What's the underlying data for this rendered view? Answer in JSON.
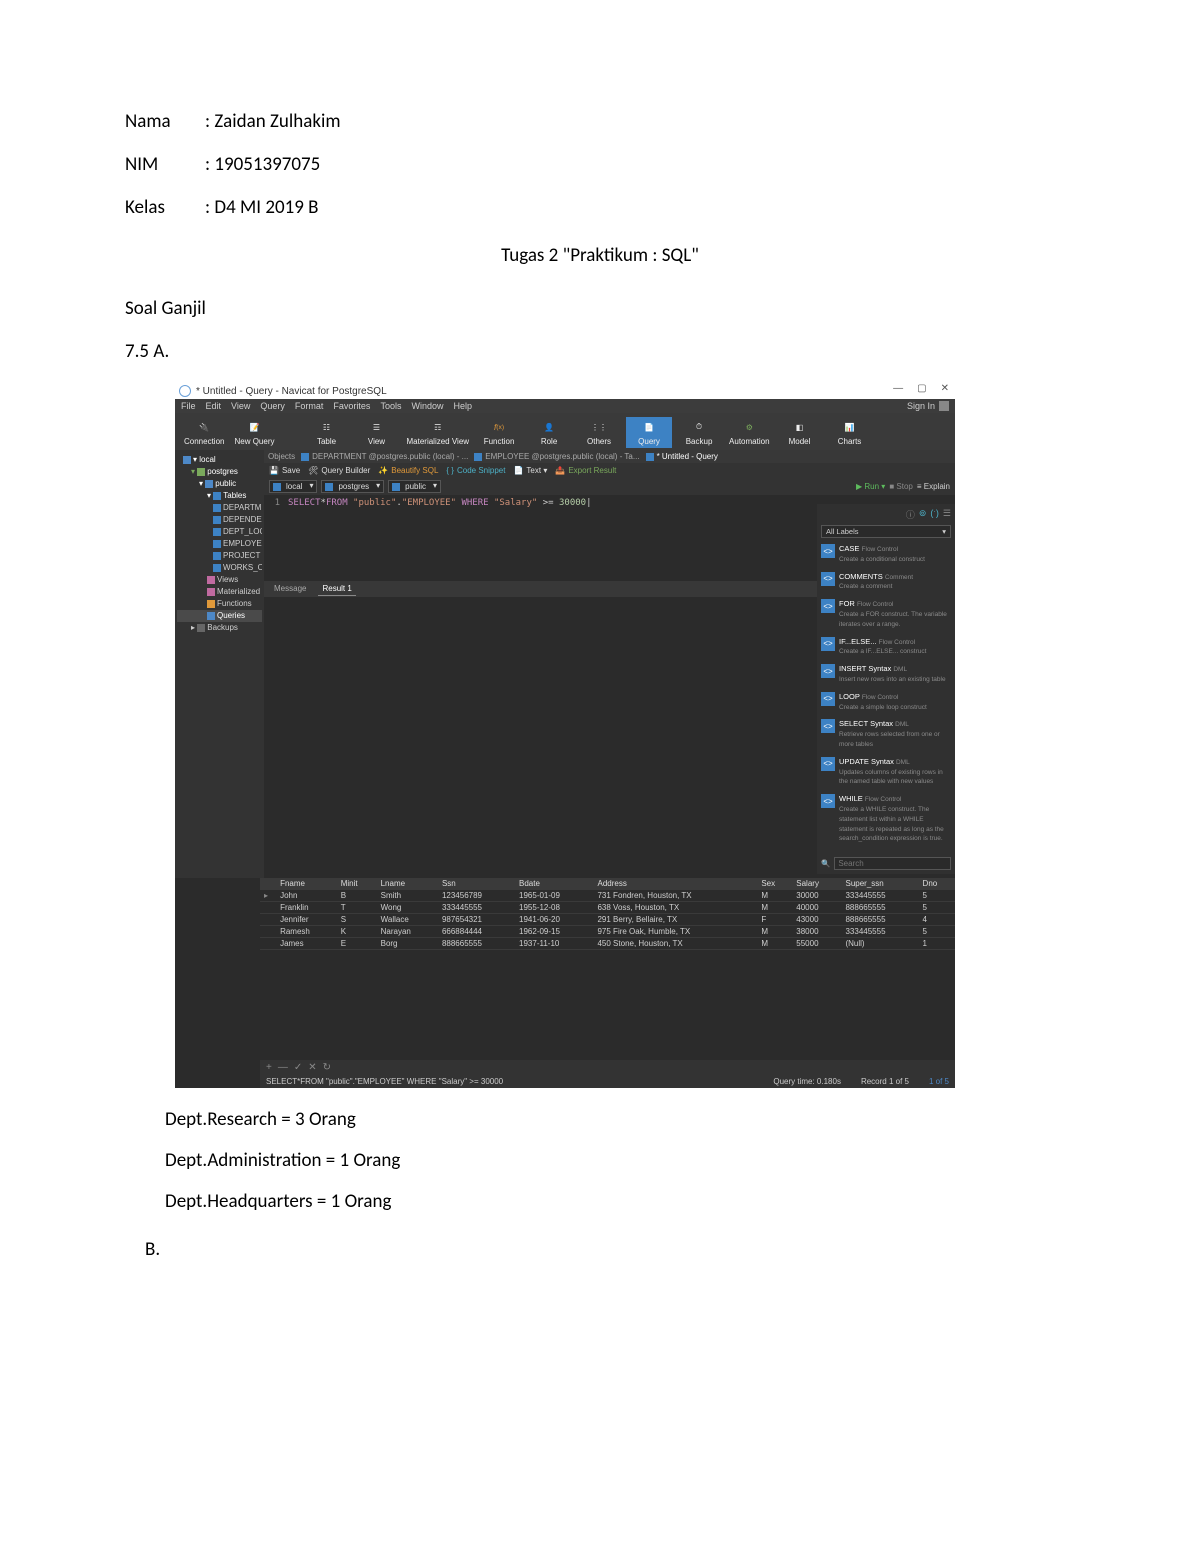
{
  "doc": {
    "nama_label": "Nama",
    "nim_label": "NIM",
    "kelas_label": "Kelas",
    "nama": ": Zaidan Zulhakim",
    "nim": ": 19051397075",
    "kelas": ": D4 MI 2019 B",
    "title": "Tugas 2 \"Praktikum : SQL\"",
    "soal": "Soal Ganjil",
    "q75a": "7.5 A.",
    "res1": "Dept.Research = 3 Orang",
    "res2": "Dept.Administration = 1 Orang",
    "res3": "Dept.Headquarters = 1 Orang",
    "B": "B."
  },
  "app": {
    "window_title": "* Untitled - Query - Navicat for PostgreSQL",
    "win_min": "—",
    "win_max": "▢",
    "win_close": "✕",
    "menus": [
      "File",
      "Edit",
      "View",
      "Query",
      "Format",
      "Favorites",
      "Tools",
      "Window",
      "Help"
    ],
    "signin": "Sign In",
    "toolbar": {
      "connection": "Connection",
      "newquery": "New Query",
      "table": "Table",
      "view": "View",
      "matview": "Materialized View",
      "function": "Function",
      "role": "Role",
      "others": "Others",
      "query": "Query",
      "backup": "Backup",
      "automation": "Automation",
      "model": "Model",
      "charts": "Charts"
    },
    "tree": {
      "local": "local",
      "postgres": "postgres",
      "public": "public",
      "tables": "Tables",
      "t1": "DEPARTMENT",
      "t2": "DEPENDENT",
      "t3": "DEPT_LOCATION",
      "t4": "EMPLOYEE",
      "t5": "PROJECT",
      "t6": "WORKS_ON",
      "views": "Views",
      "mviews": "Materialized Views",
      "functions": "Functions",
      "queries": "Queries",
      "backups": "Backups"
    },
    "tabs": {
      "objects": "Objects",
      "t1": "DEPARTMENT @postgres.public (local) - ...",
      "t2": "EMPLOYEE @postgres.public (local) - Ta...",
      "active": "* Untitled - Query"
    },
    "qtool": {
      "save": "Save",
      "qb": "Query Builder",
      "beautify": "Beautify SQL",
      "snippet": "Code Snippet",
      "text": "Text ▾",
      "export": "Export Result"
    },
    "conn": {
      "local": "local",
      "db": "postgres",
      "schema": "public",
      "run": "Run ▾",
      "stop": "Stop",
      "explain": "Explain"
    },
    "sql_line": "1",
    "sql": "SELECT*FROM \"public\".\"EMPLOYEE\" WHERE \"Salary\" >= 30000",
    "sql_cursor": "|",
    "result_tabs": {
      "msg": "Message",
      "r1": "Result 1"
    },
    "columns": [
      "Fname",
      "Minit",
      "Lname",
      "Ssn",
      "Bdate",
      "Address",
      "Sex",
      "Salary",
      "Super_ssn",
      "Dno"
    ],
    "rows": [
      {
        "Fname": "John",
        "Minit": "B",
        "Lname": "Smith",
        "Ssn": "123456789",
        "Bdate": "1965-01-09",
        "Address": "731 Fondren, Houston, TX",
        "Sex": "M",
        "Salary": "30000",
        "Super_ssn": "333445555",
        "Dno": "5"
      },
      {
        "Fname": "Franklin",
        "Minit": "T",
        "Lname": "Wong",
        "Ssn": "333445555",
        "Bdate": "1955-12-08",
        "Address": "638 Voss, Houston, TX",
        "Sex": "M",
        "Salary": "40000",
        "Super_ssn": "888665555",
        "Dno": "5"
      },
      {
        "Fname": "Jennifer",
        "Minit": "S",
        "Lname": "Wallace",
        "Ssn": "987654321",
        "Bdate": "1941-06-20",
        "Address": "291 Berry, Bellaire, TX",
        "Sex": "F",
        "Salary": "43000",
        "Super_ssn": "888665555",
        "Dno": "4"
      },
      {
        "Fname": "Ramesh",
        "Minit": "K",
        "Lname": "Narayan",
        "Ssn": "666884444",
        "Bdate": "1962-09-15",
        "Address": "975 Fire Oak, Humble, TX",
        "Sex": "M",
        "Salary": "38000",
        "Super_ssn": "333445555",
        "Dno": "5"
      },
      {
        "Fname": "James",
        "Minit": "E",
        "Lname": "Borg",
        "Ssn": "888665555",
        "Bdate": "1937-11-10",
        "Address": "450 Stone, Houston, TX",
        "Sex": "M",
        "Salary": "55000",
        "Super_ssn": "(Null)",
        "Dno": "1"
      }
    ],
    "gridctl": {
      "add": "+",
      "del": "—",
      "ok": "✓",
      "cancel": "✕",
      "refresh": "↻"
    },
    "status": {
      "sql": "SELECT*FROM \"public\".\"EMPLOYEE\" WHERE \"Salary\" >= 30000",
      "time": "Query time: 0.180s",
      "rec": "Record 1 of 5",
      "page": "1 of 5"
    },
    "rpanel": {
      "all_labels": "All Labels",
      "snips": [
        {
          "t": "CASE",
          "s": "Flow Control",
          "d": "Create a conditional construct"
        },
        {
          "t": "COMMENTS",
          "s": "Comment",
          "d": "Create a comment"
        },
        {
          "t": "FOR",
          "s": "Flow Control",
          "d": "Create a FOR construct. The variable iterates over a range."
        },
        {
          "t": "IF...ELSE...",
          "s": "Flow Control",
          "d": "Create a IF...ELSE... construct"
        },
        {
          "t": "INSERT Syntax",
          "s": "DML",
          "d": "Insert new rows into an existing table"
        },
        {
          "t": "LOOP",
          "s": "Flow Control",
          "d": "Create a simple loop construct"
        },
        {
          "t": "SELECT Syntax",
          "s": "DML",
          "d": "Retrieve rows selected from one or more tables"
        },
        {
          "t": "UPDATE Syntax",
          "s": "DML",
          "d": "Updates columns of existing rows in the named table with new values"
        },
        {
          "t": "WHILE",
          "s": "Flow Control",
          "d": "Create a WHILE construct. The statement list within a WHILE statement is repeated as long as the search_condition expression is true."
        }
      ],
      "search_ph": "Search"
    }
  }
}
